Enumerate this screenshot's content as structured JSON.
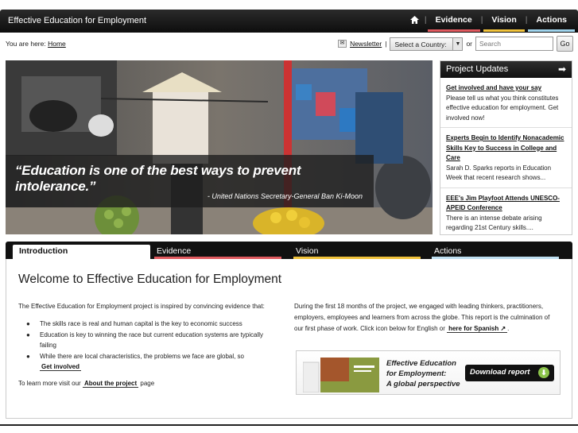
{
  "header": {
    "brand": "Effective Education for Employment",
    "nav": [
      {
        "label": "Evidence",
        "color": "#e05a5f"
      },
      {
        "label": "Vision",
        "color": "#f0c23b"
      },
      {
        "label": "Actions",
        "color": "#9fd3ec"
      }
    ]
  },
  "util": {
    "crumb_prefix": "You are here:",
    "crumb_home": "Home",
    "newsletter": "Newsletter",
    "country_select": "Select a Country:",
    "or": "or",
    "search_placeholder": "Search",
    "go": "Go"
  },
  "hero": {
    "quote": "“Education is one of the best ways to prevent intolerance.”",
    "attribution": "- United Nations Secretary-General Ban Ki-Moon"
  },
  "updates": {
    "title": "Project Updates",
    "items": [
      {
        "title": "Get involved and have your say",
        "body": "Please tell us what you think constitutes effective education for employment. Get involved now!"
      },
      {
        "title": "Experts Begin to Identify Nonacademic Skills Key to Success in College and Care",
        "body": "Sarah D. Sparks reports in Education Week that recent research shows..."
      },
      {
        "title": "EEE's Jim Playfoot Attends UNESCO-APEID Conference",
        "body": "There is an intense debate arising regarding 21st Century skills...."
      }
    ]
  },
  "tabs": [
    {
      "label": "Introduction",
      "color": "#ffffff"
    },
    {
      "label": "Evidence",
      "color": "#e05a5f"
    },
    {
      "label": "Vision",
      "color": "#f0c23b"
    },
    {
      "label": "Actions",
      "color": "#bfe0f2"
    }
  ],
  "intro": {
    "heading": "Welcome to Effective Education for Employment",
    "lead": "The Effective Education for Employment project is inspired by convincing evidence that:",
    "bullets": [
      "The skills race is real and human capital is the key to economic success",
      "Education is key to winning the race but current education systems are typically failing",
      "While there are local characteristics, the problems we face are global, so"
    ],
    "get_involved": "Get involved",
    "learn_prefix": "To learn more visit our",
    "about_link": "About the project",
    "learn_suffix": "page",
    "col2_text": "During the first 18 months of the project, we engaged with leading thinkers, practitioners, employers, employees and learners from across the globe. This report is the culmination of our first phase of work. Click icon below for English or",
    "spanish_link": "here for Spanish",
    "report_title_1": "Effective Education",
    "report_title_2": "for Employment:",
    "report_title_3": "A global perspective",
    "download": "Download report"
  }
}
